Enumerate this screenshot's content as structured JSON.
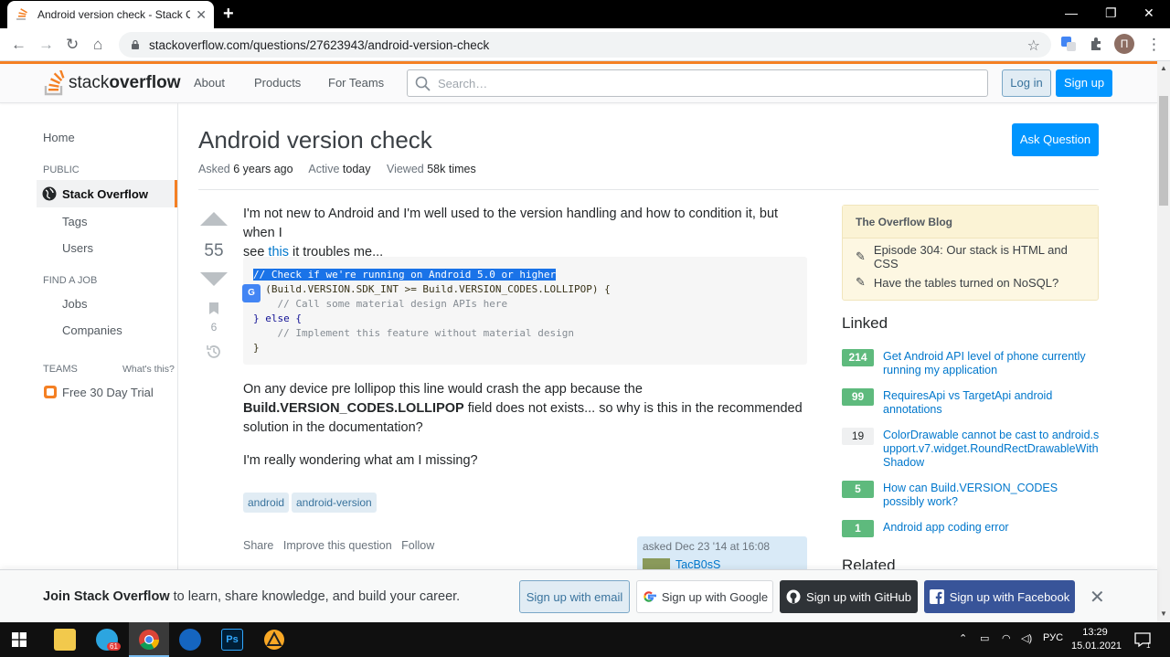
{
  "browser": {
    "tab_title": "Android version check - Stack Ov",
    "tab_close": "✕",
    "new_tab": "+",
    "url": "stackoverflow.com/questions/27623943/android-version-check",
    "profile_initial": "П"
  },
  "header": {
    "logo_stack": "stack",
    "logo_overflow": "overflow",
    "nav": [
      "About",
      "Products",
      "For Teams"
    ],
    "search_placeholder": "Search…",
    "login_label": "Log in",
    "signup_label": "Sign up"
  },
  "sidebar": {
    "home": "Home",
    "public_head": "PUBLIC",
    "active_item": "Stack Overflow",
    "tags": "Tags",
    "users": "Users",
    "job_head": "FIND A JOB",
    "jobs": "Jobs",
    "companies": "Companies",
    "teams_head": "TEAMS",
    "whats_this": "What's this?",
    "trial": "Free 30 Day Trial"
  },
  "question": {
    "title": "Android version check",
    "asked_label": "Asked",
    "asked_value": "6 years ago",
    "active_label": "Active",
    "active_value": "today",
    "viewed_label": "Viewed",
    "viewed_value": "58k times",
    "ask_button": "Ask Question",
    "votes": "55",
    "bookmarks": "6",
    "para1_a": "I'm not new to Android and I'm well used to the version handling and how to condition it, but when I",
    "para1_b_pre": "see ",
    "para1_link": "this",
    "para1_b_post": " it troubles me...",
    "code_line1": "// Check if we're running on Android 5.0 or higher",
    "code_line2": " (Build.VERSION.SDK_INT >= Build.VERSION_CODES.LOLLIPOP) {",
    "code_line3": "    // Call some material design APIs here",
    "code_line4_kw": "} else {",
    "code_line5": "    // Implement this feature without material design",
    "code_line6": "}",
    "translate_badge": "G",
    "para2_a": "On any device pre lollipop this line would crash the app because the",
    "para2_bold": "Build.VERSION_CODES.LOLLIPOP",
    "para2_b": " field does not exists... so why is this in the recommended",
    "para2_c": "solution in the documentation?",
    "para3": "I'm really wondering what am I missing?",
    "tags": [
      "android",
      "android-version"
    ],
    "menu": [
      "Share",
      "Improve this question",
      "Follow"
    ],
    "asked_card": "asked Dec 23 '14 at 16:08",
    "owner_name": "TacB0sS"
  },
  "blog": {
    "head": "The Overflow Blog",
    "items": [
      "Episode 304: Our stack is HTML and CSS",
      "Have the tables turned on NoSQL?"
    ]
  },
  "linked": {
    "head": "Linked",
    "items": [
      {
        "score": "214",
        "text": "Get Android API level of phone currently running my application",
        "accepted": true
      },
      {
        "score": "99",
        "text": "RequiresApi vs TargetApi android annotations",
        "accepted": true
      },
      {
        "score": "19",
        "text": "ColorDrawable cannot be cast to android.support.v7.widget.RoundRectDrawableWithShadow",
        "accepted": false
      },
      {
        "score": "5",
        "text": "How can Build.VERSION_CODES possibly work?",
        "accepted": true
      },
      {
        "score": "1",
        "text": "Android app coding error",
        "accepted": true
      }
    ]
  },
  "related_head": "Related",
  "banner": {
    "bold": "Join Stack Overflow",
    "rest": " to learn, share knowledge, and build your career.",
    "email": "Sign up with email",
    "google": "Sign up with Google",
    "github": "Sign up with GitHub",
    "facebook": "Sign up with Facebook"
  },
  "taskbar": {
    "telegram_badge": "61",
    "lang": "РУС",
    "time": "13:29",
    "date": "15.01.2021",
    "notif_count": "1"
  },
  "colors": {
    "accent": "#f48024",
    "primary_button": "#0095ff",
    "link": "#0077cc",
    "accepted": "#5eba7d"
  }
}
